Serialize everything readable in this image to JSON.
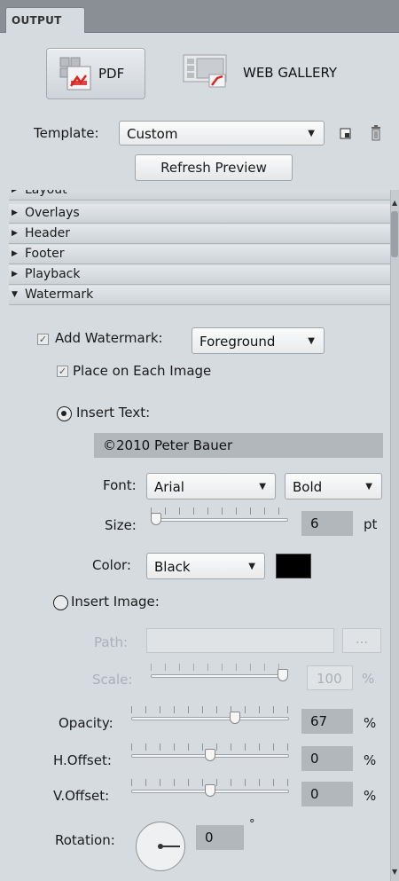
{
  "panel": {
    "tab_label": "OUTPUT"
  },
  "outputs": {
    "pdf_label": "PDF",
    "web_gallery_label": "WEB GALLERY"
  },
  "template": {
    "label": "Template:",
    "value": "Custom",
    "refresh_label": "Refresh Preview"
  },
  "sections": {
    "clipped_label": "Layout",
    "items": [
      "Overlays",
      "Header",
      "Footer",
      "Playback",
      "Watermark"
    ]
  },
  "watermark": {
    "add_label": "Add Watermark:",
    "add_checked": true,
    "position_value": "Foreground",
    "place_each_label": "Place on Each Image",
    "place_each_checked": true,
    "insert_text_label": "Insert Text:",
    "text_value": "©2010 Peter Bauer",
    "font_label": "Font:",
    "font_value": "Arial",
    "style_value": "Bold",
    "size_label": "Size:",
    "size_value": "6",
    "size_unit": "pt",
    "color_label": "Color:",
    "color_value": "Black",
    "color_hex": "#000000",
    "insert_image_label": "Insert Image:",
    "path_label": "Path:",
    "path_value": "",
    "browse_label": "...",
    "scale_label": "Scale:",
    "scale_value": "100",
    "scale_unit": "%",
    "opacity_label": "Opacity:",
    "opacity_value": "67",
    "opacity_unit": "%",
    "hoffset_label": "H.Offset:",
    "hoffset_value": "0",
    "hoffset_unit": "%",
    "voffset_label": "V.Offset:",
    "voffset_value": "0",
    "voffset_unit": "%",
    "rotation_label": "Rotation:",
    "rotation_value": "0",
    "rotation_unit": "°"
  },
  "sliders": {
    "size_fraction": 0.0,
    "scale_fraction": 1.0,
    "opacity_fraction": 0.67,
    "hoffset_fraction": 0.5,
    "voffset_fraction": 0.5
  },
  "colors": {
    "watermark_color": "#000000"
  },
  "icons": [
    "pdf-icon",
    "web-gallery-icon",
    "save-template-icon",
    "trash-icon",
    "disclosure-triangle-icon",
    "scroll-up-arrow-icon",
    "scroll-down-arrow-icon"
  ]
}
